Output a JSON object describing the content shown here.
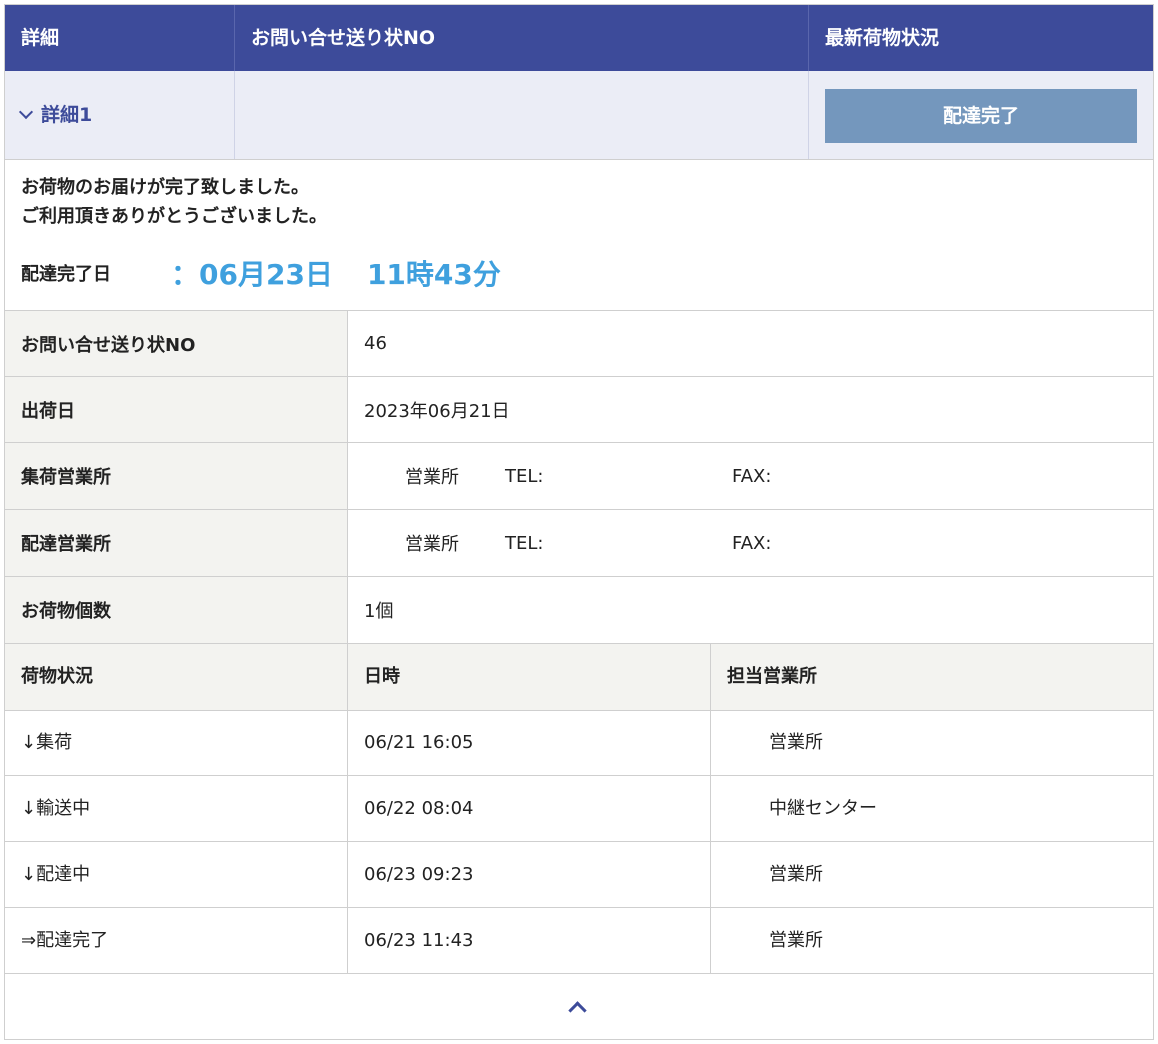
{
  "header": {
    "col_detail": "詳細",
    "col_tracking_no": "お問い合せ送り状NO",
    "col_latest_status": "最新荷物状況"
  },
  "summary": {
    "detail_toggle": "詳細1",
    "status_button": "配達完了"
  },
  "message": {
    "line1": "お荷物のお届けが完了致しました。",
    "line2": "ご利用頂きありがとうございました。",
    "completed_label": "配達完了日",
    "completed_date": "：06月23日",
    "completed_time": "11時43分"
  },
  "info": {
    "tracking_no_label": "お問い合せ送り状NO",
    "tracking_no_value": "46",
    "ship_date_label": "出荷日",
    "ship_date_value": "2023年06月21日",
    "pickup_office_label": "集荷営業所",
    "pickup_office_name": "営業所",
    "pickup_office_tel": "TEL:",
    "pickup_office_fax": "FAX:",
    "delivery_office_label": "配達営業所",
    "delivery_office_name": "営業所",
    "delivery_office_tel": "TEL:",
    "delivery_office_fax": "FAX:",
    "package_count_label": "お荷物個数",
    "package_count_value": "1個"
  },
  "history": {
    "headers": [
      "荷物状況",
      "日時",
      "担当営業所"
    ],
    "rows": [
      {
        "status": "↓集荷",
        "datetime": "06/21 16:05",
        "office": "営業所"
      },
      {
        "status": "↓輸送中",
        "datetime": "06/22 08:04",
        "office": "中継センター"
      },
      {
        "status": "↓配達中",
        "datetime": "06/23 09:23",
        "office": "営業所"
      },
      {
        "status": "⇒配達完了",
        "datetime": "06/23 11:43",
        "office": "営業所"
      }
    ]
  },
  "icons": {
    "toggle": "chevron-down-icon",
    "collapse": "chevron-up-icon"
  },
  "colors": {
    "header_bg": "#3d4b9a",
    "status_button_bg": "#7497bd",
    "completed_datetime": "#3fa0de",
    "label_cell_bg": "#f3f3f0",
    "summary_row_bg": "#ebedf6"
  }
}
